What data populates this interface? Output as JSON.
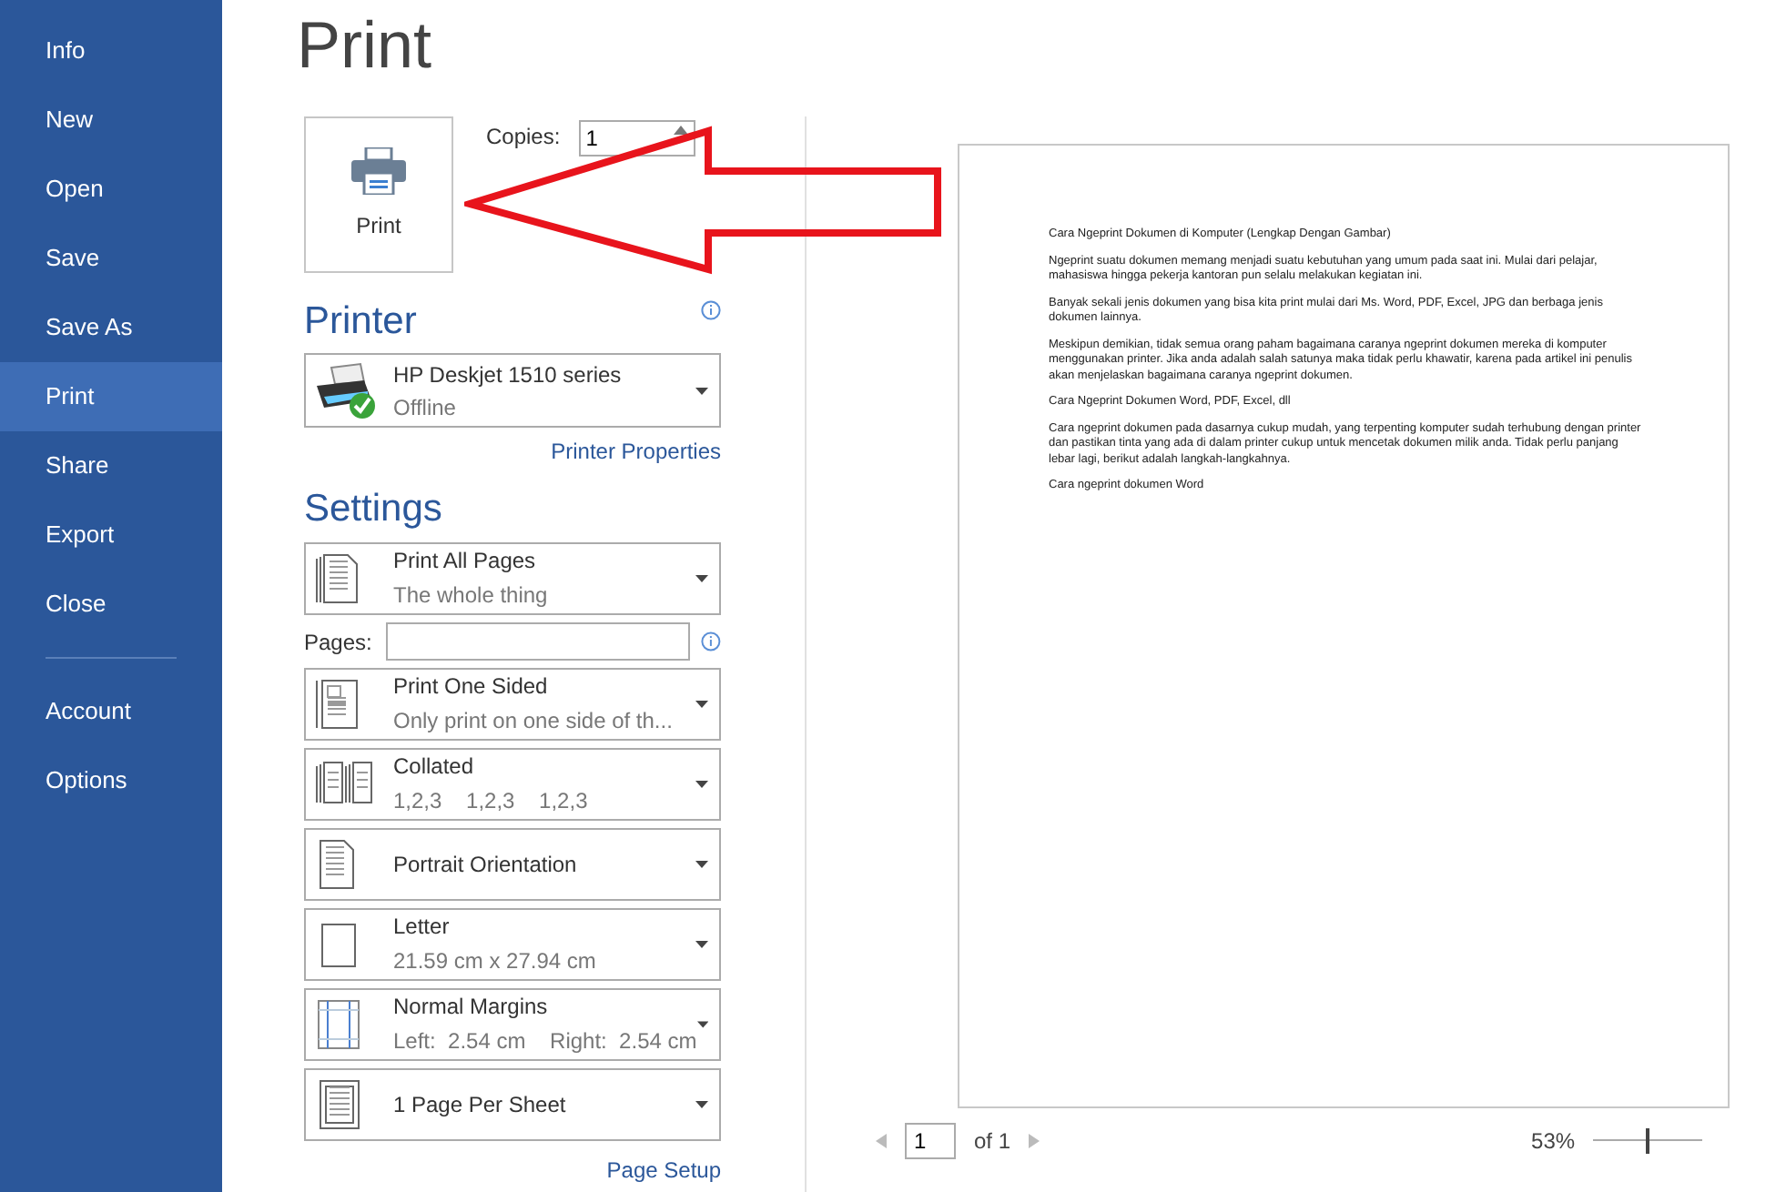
{
  "sidebar": {
    "items": [
      {
        "label": "Info",
        "selected": false
      },
      {
        "label": "New",
        "selected": false
      },
      {
        "label": "Open",
        "selected": false
      },
      {
        "label": "Save",
        "selected": false
      },
      {
        "label": "Save As",
        "selected": false
      },
      {
        "label": "Print",
        "selected": true
      },
      {
        "label": "Share",
        "selected": false
      },
      {
        "label": "Export",
        "selected": false
      },
      {
        "label": "Close",
        "selected": false
      }
    ],
    "bottom_items": [
      {
        "label": "Account",
        "selected": false
      },
      {
        "label": "Options",
        "selected": false
      }
    ]
  },
  "title": "Print",
  "print_button": {
    "label": "Print"
  },
  "copies": {
    "label": "Copies:",
    "value": "1"
  },
  "printer": {
    "heading": "Printer",
    "name": "HP Deskjet 1510 series",
    "status": "Offline",
    "link": "Printer Properties"
  },
  "settings": {
    "heading": "Settings",
    "pages": {
      "label": "Pages:"
    },
    "options": [
      {
        "kind": "pages",
        "title": "Print All Pages",
        "subtitle": "The whole thing"
      },
      {
        "kind": "sided",
        "title": "Print One Sided",
        "subtitle": "Only print on one side of th..."
      },
      {
        "kind": "collated",
        "title": "Collated",
        "subtitle": "1,2,3    1,2,3    1,2,3"
      },
      {
        "kind": "portrait",
        "title": "Portrait Orientation"
      },
      {
        "kind": "letter",
        "title": "Letter",
        "subtitle": "21.59 cm x 27.94 cm"
      },
      {
        "kind": "margins",
        "title": "Normal Margins",
        "subtitle": "Left:  2.54 cm    Right:  2.54 cm"
      },
      {
        "kind": "sheet",
        "title": "1 Page Per Sheet"
      }
    ],
    "link": "Page Setup"
  },
  "preview": {
    "paragraphs": [
      "Cara Ngeprint Dokumen di Komputer (Lengkap Dengan Gambar)",
      "Ngeprint suatu dokumen memang menjadi suatu kebutuhan yang umum pada saat ini. Mulai dari pelajar, mahasiswa hingga pekerja kantoran pun selalu melakukan kegiatan ini.",
      "Banyak sekali jenis dokumen yang bisa kita print mulai dari Ms. Word, PDF, Excel, JPG dan berbaga jenis dokumen lainnya.",
      "Meskipun demikian, tidak semua orang paham bagaimana caranya ngeprint dokumen mereka di komputer menggunakan printer. Jika anda adalah salah satunya maka tidak perlu khawatir, karena pada artikel ini penulis akan menjelaskan bagaimana caranya ngeprint dokumen.",
      "Cara Ngeprint Dokumen Word, PDF, Excel, dll",
      "Cara ngeprint dokumen pada dasarnya cukup mudah, yang terpenting komputer sudah terhubung dengan printer dan pastikan tinta yang ada di dalam printer cukup untuk mencetak dokumen milik anda. Tidak perlu panjang lebar lagi, berikut adalah langkah-langkahnya.",
      "Cara ngeprint dokumen Word"
    ]
  },
  "pager": {
    "page": "1",
    "of": "of 1",
    "zoom": "53%",
    "zoom_slider": {
      "level": 0.5
    }
  }
}
